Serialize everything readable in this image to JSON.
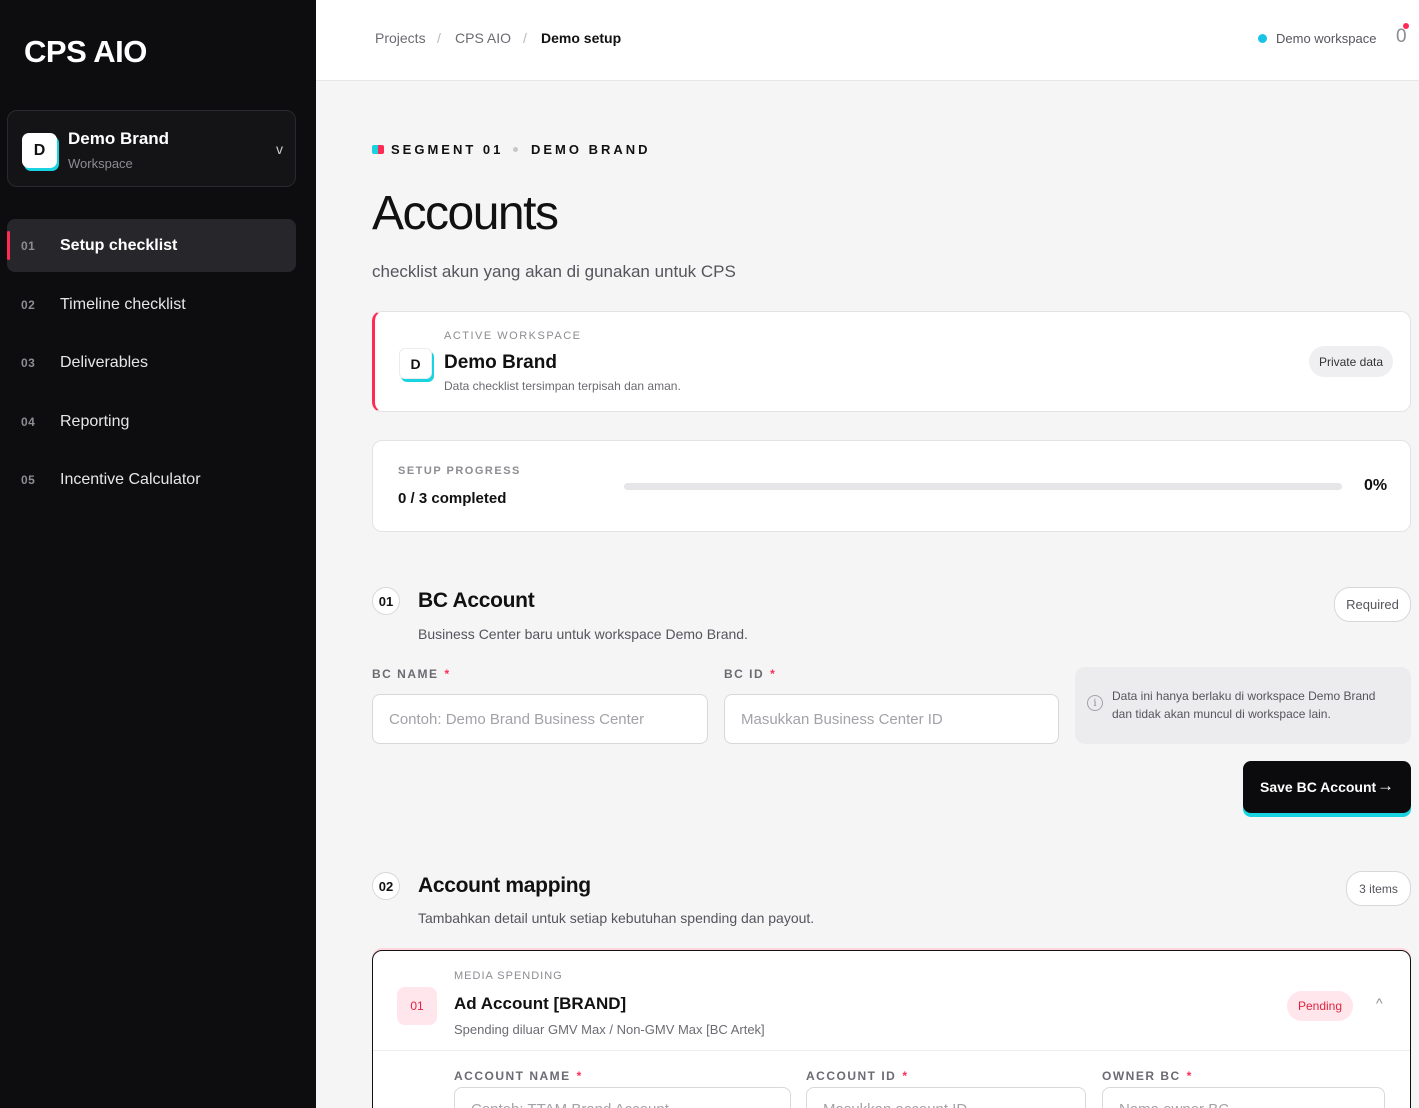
{
  "app": {
    "logo": "CPS AIO"
  },
  "workspace_switcher": {
    "initial": "D",
    "name": "Demo Brand",
    "sub": "Workspace",
    "chevron": "v"
  },
  "sidebar": {
    "items": [
      {
        "num": "01",
        "label": "Setup checklist",
        "active": true
      },
      {
        "num": "02",
        "label": "Timeline checklist"
      },
      {
        "num": "03",
        "label": "Deliverables"
      },
      {
        "num": "04",
        "label": "Reporting"
      },
      {
        "num": "05",
        "label": "Incentive Calculator"
      }
    ]
  },
  "breadcrumb": {
    "items": [
      "Projects",
      "CPS AIO",
      "Demo setup"
    ],
    "separator": "/"
  },
  "topbar": {
    "workspace_label": "Demo workspace",
    "notification_glyph": "0",
    "status_color": "#19c3e6"
  },
  "segment": {
    "label": "SEGMENT 01",
    "brand": "DEMO BRAND"
  },
  "page": {
    "title": "Accounts",
    "subtitle": "checklist akun yang akan di gunakan untuk CPS"
  },
  "active_workspace": {
    "kicker": "ACTIVE WORKSPACE",
    "initial": "D",
    "name": "Demo Brand",
    "description": "Data checklist tersimpan terpisah dan aman.",
    "badge": "Private data"
  },
  "progress": {
    "kicker": "SETUP PROGRESS",
    "count": "0 / 3 completed",
    "percent_label": "0%",
    "percent": 0
  },
  "bc_section": {
    "num": "01",
    "title": "BC Account",
    "description": "Business Center baru untuk workspace Demo Brand.",
    "badge": "Required",
    "name_label": "BC NAME",
    "name_placeholder": "Contoh: Demo Brand Business Center",
    "id_label": "BC ID",
    "id_placeholder": "Masukkan Business Center ID",
    "required_mark": "*",
    "info_icon": "i",
    "info": "Data ini hanya berlaku di workspace Demo Brand dan tidak akan muncul di workspace lain.",
    "save_label": "Save BC Account",
    "save_icon": "→"
  },
  "mapping_section": {
    "num": "02",
    "title": "Account mapping",
    "description": "Tambahkan detail untuk setiap kebutuhan spending dan payout.",
    "badge": "3 items"
  },
  "account_card": {
    "num": "01",
    "kicker": "MEDIA SPENDING",
    "title": "Ad Account [BRAND]",
    "description": "Spending diluar GMV Max / Non-GMV Max [BC Artek]",
    "status": "Pending",
    "chevron": "^",
    "fields": [
      {
        "label": "ACCOUNT NAME",
        "placeholder": "Contoh: TTAM Brand Account"
      },
      {
        "label": "ACCOUNT ID",
        "placeholder": "Masukkan account ID"
      },
      {
        "label": "OWNER BC",
        "placeholder": "Nama owner BC"
      }
    ]
  },
  "colors": {
    "accent_red": "#ff2b55",
    "accent_cyan": "#19d3e0",
    "sidebar_bg": "#0d0d0f"
  }
}
